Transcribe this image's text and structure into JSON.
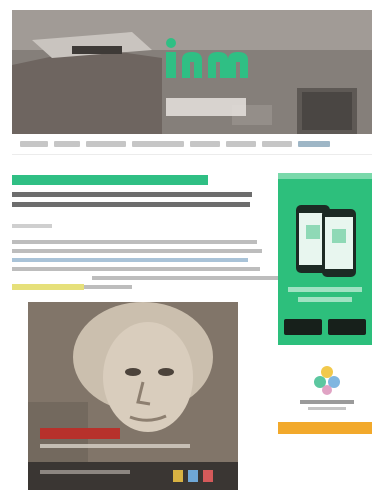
{
  "site": {
    "name": "",
    "brand_color": "#2fbf84"
  },
  "nav": {
    "items": [
      {
        "label": ""
      },
      {
        "label": ""
      },
      {
        "label": ""
      },
      {
        "label": ""
      },
      {
        "label": ""
      },
      {
        "label": ""
      },
      {
        "label": ""
      },
      {
        "label": ""
      }
    ]
  },
  "article": {
    "category": "",
    "headline": "",
    "byline": "",
    "body": "",
    "image_caption": ""
  },
  "sidebar": {
    "ad_text": "",
    "partner_name": "",
    "cta_label": ""
  },
  "colors": {
    "accent": "#2fbf84",
    "link": "#a9c3d8",
    "caption_red": "#b7312b",
    "cta_orange": "#f2a92b"
  }
}
